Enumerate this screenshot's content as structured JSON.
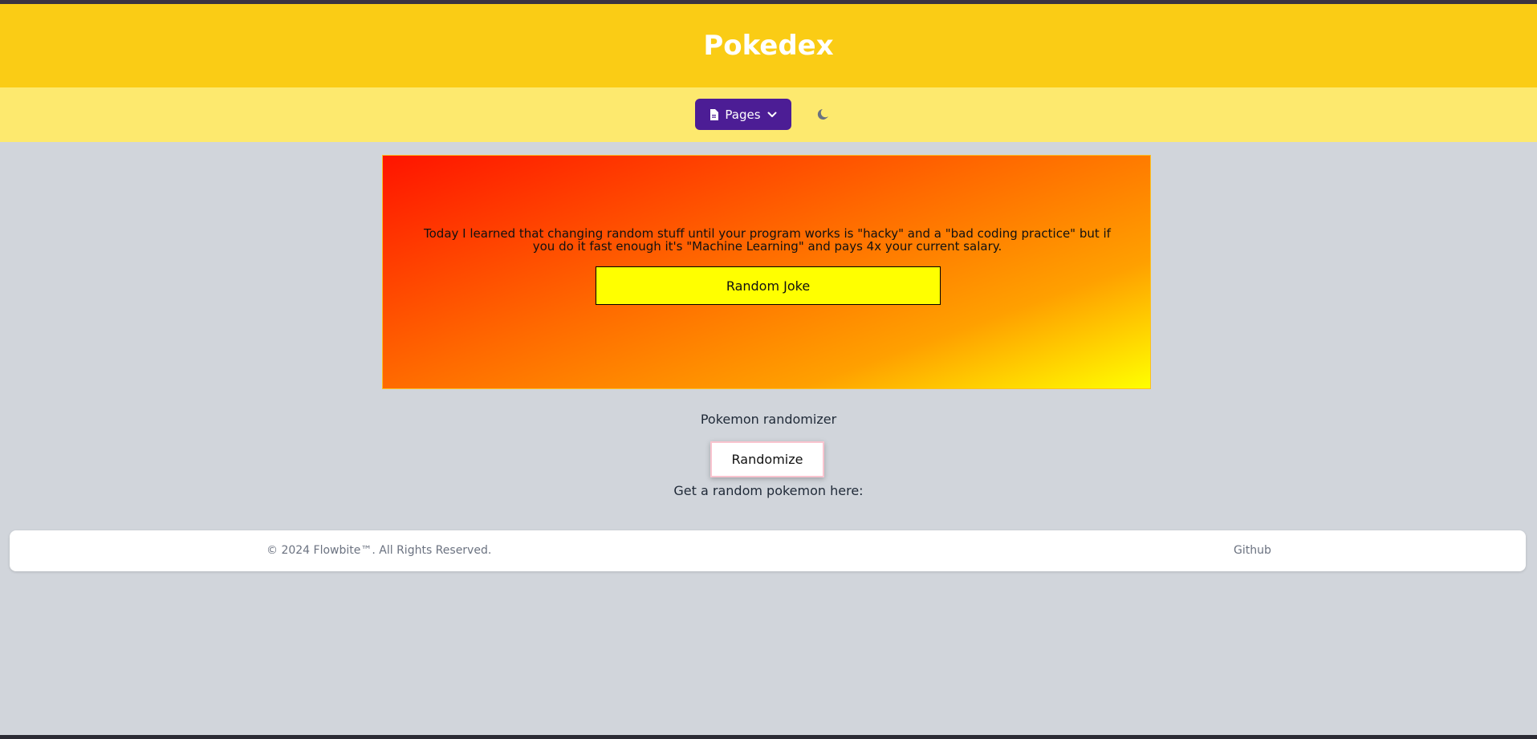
{
  "header": {
    "title": "Pokedex"
  },
  "nav": {
    "pages_label": "Pages",
    "pages_icon": "document-icon",
    "dropdown_icon": "chevron-down-icon",
    "theme_icon": "moon-icon"
  },
  "joke": {
    "text": "Today I learned that changing random stuff until your program works is \"hacky\" and a \"bad coding practice\" but if you do it fast enough it's \"Machine Learning\" and pays 4x your current salary.",
    "button_label": "Random Joke"
  },
  "randomizer": {
    "title": "Pokemon randomizer",
    "button_label": "Randomize",
    "caption": "Get a random pokemon here:"
  },
  "footer": {
    "copyright": "© 2024 Flowbite™. All Rights Reserved.",
    "github_label": "Github"
  },
  "colors": {
    "header_bg": "#facc15",
    "navbar_bg": "#fde96e",
    "pages_button_bg": "#4c1d95",
    "page_bg": "#d1d5db",
    "joke_button_bg": "#ffff00"
  }
}
